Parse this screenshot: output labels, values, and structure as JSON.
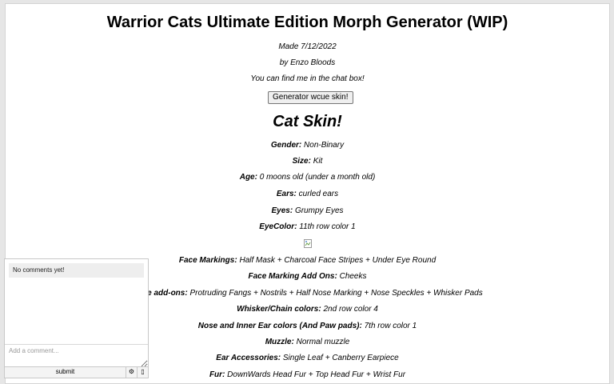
{
  "page": {
    "title": "Warrior Cats Ultimate Edition Morph Generator (WIP)",
    "made": "Made 7/12/2022",
    "author": "by Enzo Bloods",
    "contact": "You can find me in the chat box!",
    "generate_button": "Generator wcue skin!",
    "skin_heading": "Cat Skin!"
  },
  "traits": [
    {
      "label": "Gender",
      "value": " Non-Binary"
    },
    {
      "label": "Size",
      "value": " Kit"
    },
    {
      "label": "Age",
      "value": " 0 moons old (under a month old)"
    },
    {
      "label": "Ears",
      "value": " curled ears"
    },
    {
      "label": "Eyes",
      "value": " Grumpy Eyes"
    },
    {
      "label": "EyeColor",
      "value": " 11th row color 1"
    },
    {
      "label": "Face Markings",
      "value": " Half Mask + Charcoal Face Stripes + Under Eye Round"
    },
    {
      "label": "Face Marking Add Ons",
      "value": " Cheeks"
    },
    {
      "label": "Nose add-ons",
      "value": " Protruding Fangs + Nostrils + Half Nose Marking + Nose Speckles + Whisker Pads"
    },
    {
      "label": "Whisker/Chain colors",
      "value": " 2nd row color 4"
    },
    {
      "label": "Nose and Inner Ear colors (And Paw pads)",
      "value": " 7th row color 1"
    },
    {
      "label": "Muzzle",
      "value": " Normal muzzle"
    },
    {
      "label": "Ear Accessories",
      "value": " Single Leaf + Canberry Earpiece"
    },
    {
      "label": "Fur",
      "value": " DownWards Head Fur + Top Head Fur + Wrist Fur"
    }
  ],
  "comments": {
    "empty_text": "No comments yet!",
    "placeholder": "Add a comment...",
    "submit_label": "submit",
    "settings_glyph": "⚙",
    "expand_glyph": "▯"
  },
  "icons": {
    "broken_image": "broken-image-icon",
    "settings": "gear-icon",
    "expand": "expand-icon"
  }
}
